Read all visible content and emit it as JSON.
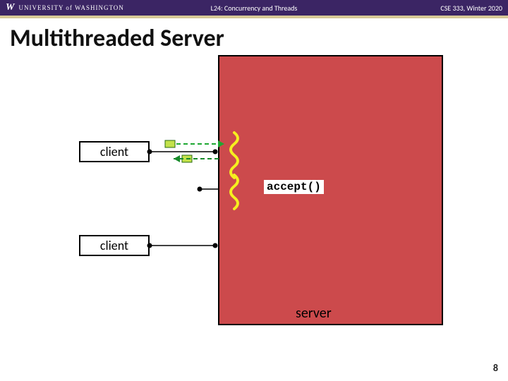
{
  "header": {
    "institution_mark": "W",
    "institution_name": "UNIVERSITY of WASHINGTON",
    "lecture": "L24: Concurrency and Threads",
    "course": "CSE 333, Winter 2020"
  },
  "title": "Multithreaded Server",
  "diagram": {
    "client1_label": "client",
    "client2_label": "client",
    "accept_label": "accept()",
    "server_label": "server"
  },
  "page_number": "8",
  "colors": {
    "header_bg": "#3b2564",
    "accent_bar": "#d7c896",
    "server_fill": "#cc4a4c",
    "squiggle": "#f6ef1f",
    "token_fill": "#c3e24a",
    "arrow_right": "#1ea832",
    "arrow_left": "#168a2a"
  }
}
